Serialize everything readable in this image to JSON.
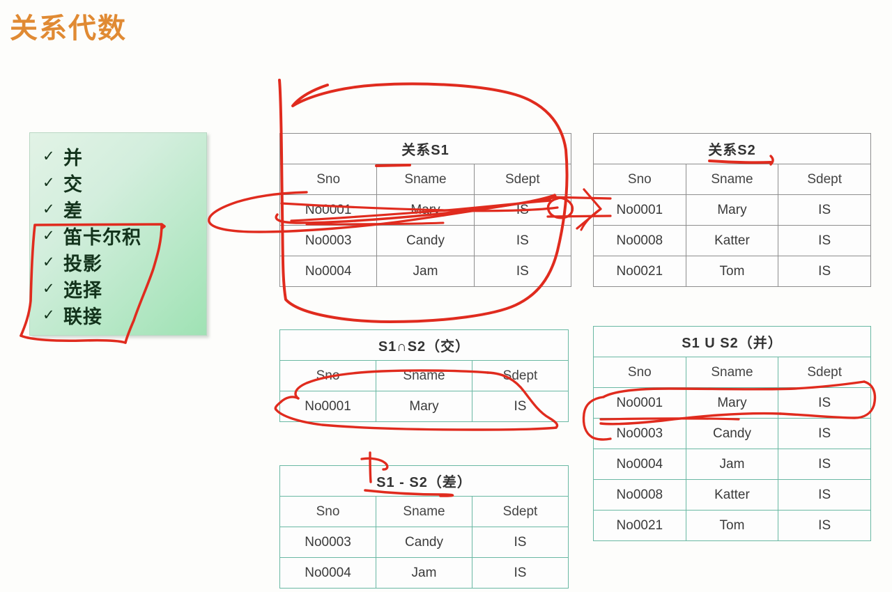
{
  "slide": {
    "title": "关系代数",
    "title_color": "#e08a33",
    "background": "#fdfdfb"
  },
  "operators_box": {
    "accent_color": "#9fe2b4",
    "check_glyph": "✓",
    "items": [
      {
        "check": "✓",
        "label": "并"
      },
      {
        "check": "✓",
        "label": "交"
      },
      {
        "check": "✓",
        "label": "差"
      },
      {
        "check": "✓",
        "label": "笛卡尔积"
      },
      {
        "check": "✓",
        "label": "投影"
      },
      {
        "check": "✓",
        "label": "选择"
      },
      {
        "check": "✓",
        "label": "联接"
      }
    ]
  },
  "tables": {
    "s1": {
      "caption": "关系S1",
      "border_color": "#8d8d8d",
      "columns": [
        "Sno",
        "Sname",
        "Sdept"
      ],
      "rows": [
        [
          "No0001",
          "Mary",
          "IS"
        ],
        [
          "No0003",
          "Candy",
          "IS"
        ],
        [
          "No0004",
          "Jam",
          "IS"
        ]
      ]
    },
    "s2": {
      "caption": "关系S2",
      "border_color": "#8d8d8d",
      "columns": [
        "Sno",
        "Sname",
        "Sdept"
      ],
      "rows": [
        [
          "No0001",
          "Mary",
          "IS"
        ],
        [
          "No0008",
          "Katter",
          "IS"
        ],
        [
          "No0021",
          "Tom",
          "IS"
        ]
      ]
    },
    "intersect": {
      "caption": "S1∩S2（交）",
      "border_color": "#69b8a3",
      "columns": [
        "Sno",
        "Sname",
        "Sdept"
      ],
      "rows": [
        [
          "No0001",
          "Mary",
          "IS"
        ]
      ]
    },
    "union": {
      "caption": "S1 U S2（并）",
      "border_color": "#69b8a3",
      "columns": [
        "Sno",
        "Sname",
        "Sdept"
      ],
      "rows": [
        [
          "No0001",
          "Mary",
          "IS"
        ],
        [
          "No0003",
          "Candy",
          "IS"
        ],
        [
          "No0004",
          "Jam",
          "IS"
        ],
        [
          "No0008",
          "Katter",
          "IS"
        ],
        [
          "No0021",
          "Tom",
          "IS"
        ]
      ]
    },
    "difference": {
      "caption": "S1 - S2（差）",
      "border_color": "#69b8a3",
      "columns": [
        "Sno",
        "Sname",
        "Sdept"
      ],
      "rows": [
        [
          "No0003",
          "Candy",
          "IS"
        ],
        [
          "No0004",
          "Jam",
          "IS"
        ]
      ]
    }
  },
  "annotations": {
    "ink_color": "#e02b1e",
    "marks": [
      {
        "name": "oval-around-s1-table",
        "shape": "large closed loop enclosing 关系S1 table"
      },
      {
        "name": "bracket-around-last-four-operators",
        "shape": "open rectangle around 笛卡尔积/投影/选择/联接"
      },
      {
        "name": "ellipse-s1-first-row",
        "shape": "ellipse around No0001 Mary IS row of S1"
      },
      {
        "name": "arrow-s1-row-to-s2-row",
        "shape": "arrow pointing right to S2 No0001 row"
      },
      {
        "name": "underline-s1-sname-header",
        "shape": "short underline under Sname"
      },
      {
        "name": "underline-s2-caption",
        "shape": "underline under 关系S2"
      },
      {
        "name": "ellipse-intersect-row",
        "shape": "ellipse around No0001 Mary IS row of S1∩S2"
      },
      {
        "name": "ellipse-union-first-row",
        "shape": "ellipse around No0001 Mary IS row of S1 U S2"
      },
      {
        "name": "tick-and-underline-difference-caption",
        "shape": "vertical tick plus underline on S1 - S2 caption"
      }
    ]
  }
}
